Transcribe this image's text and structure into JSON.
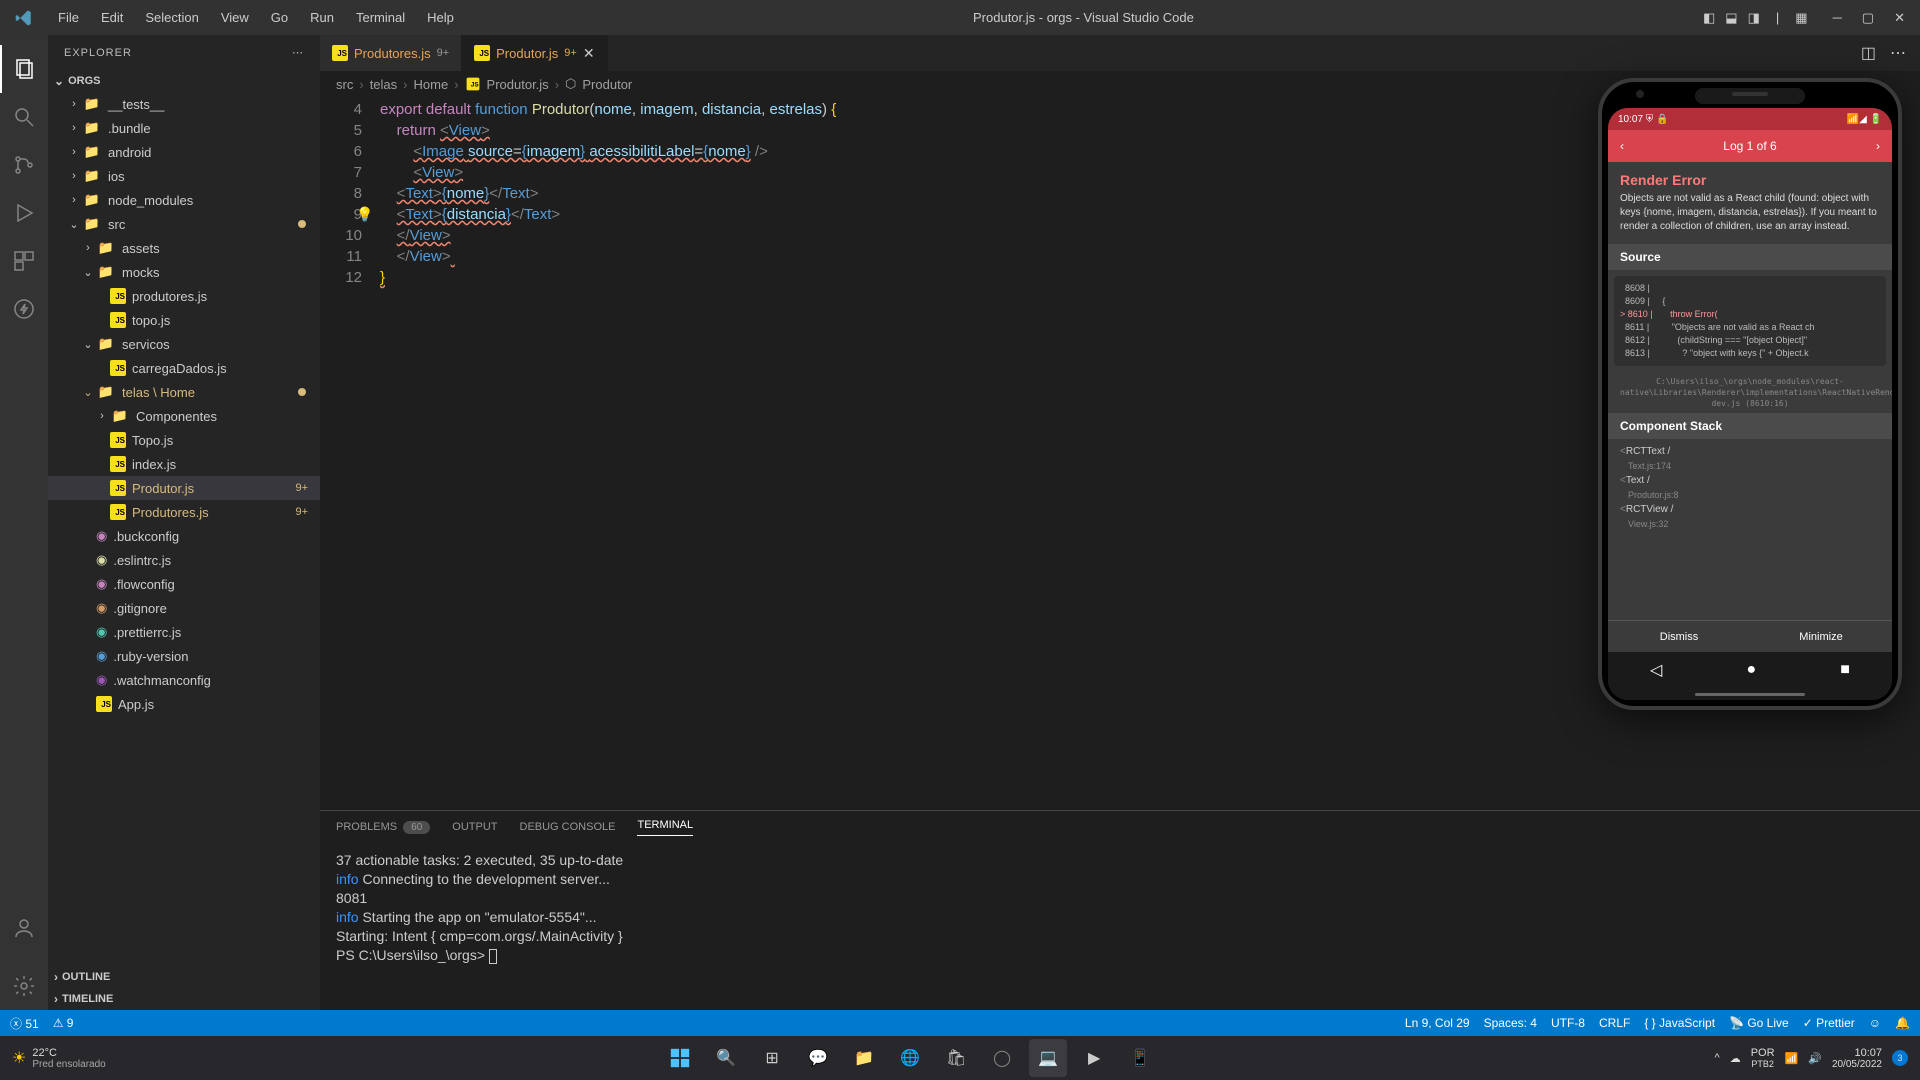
{
  "titlebar": {
    "menus": [
      "File",
      "Edit",
      "Selection",
      "View",
      "Go",
      "Run",
      "Terminal",
      "Help"
    ],
    "title": "Produtor.js - orgs - Visual Studio Code"
  },
  "sidebar": {
    "header": "EXPLORER",
    "project": "ORGS",
    "tree": [
      {
        "indent": 1,
        "chev": "›",
        "icon": "folder",
        "name": "__tests__"
      },
      {
        "indent": 1,
        "chev": "›",
        "icon": "folder",
        "name": ".bundle"
      },
      {
        "indent": 1,
        "chev": "›",
        "icon": "folder-g",
        "name": "android"
      },
      {
        "indent": 1,
        "chev": "›",
        "icon": "folder",
        "name": "ios"
      },
      {
        "indent": 1,
        "chev": "›",
        "icon": "folder-g",
        "name": "node_modules"
      },
      {
        "indent": 1,
        "chev": "⌄",
        "icon": "folder-g",
        "name": "src",
        "dot": true
      },
      {
        "indent": 2,
        "chev": "›",
        "icon": "folder",
        "name": "assets"
      },
      {
        "indent": 2,
        "chev": "⌄",
        "icon": "folder",
        "name": "mocks"
      },
      {
        "indent": 3,
        "icon": "js",
        "name": "produtores.js"
      },
      {
        "indent": 3,
        "icon": "js",
        "name": "topo.js"
      },
      {
        "indent": 2,
        "chev": "⌄",
        "icon": "folder",
        "name": "servicos"
      },
      {
        "indent": 3,
        "icon": "js",
        "name": "carregaDados.js"
      },
      {
        "indent": 2,
        "chev": "⌄",
        "icon": "folder-r",
        "name": "telas \\ Home",
        "dot": true,
        "mod": true
      },
      {
        "indent": 3,
        "chev": "›",
        "icon": "folder",
        "name": "Componentes"
      },
      {
        "indent": 3,
        "icon": "js",
        "name": "Topo.js"
      },
      {
        "indent": 3,
        "icon": "js",
        "name": "index.js"
      },
      {
        "indent": 3,
        "icon": "js",
        "name": "Produtor.js",
        "badge": "9+",
        "active": true,
        "mod": true
      },
      {
        "indent": 3,
        "icon": "js",
        "name": "Produtores.js",
        "badge": "9+",
        "mod": true
      },
      {
        "indent": 2,
        "icon": "dot-p",
        "name": ".buckconfig"
      },
      {
        "indent": 2,
        "icon": "dot-y",
        "name": ".eslintrc.js"
      },
      {
        "indent": 2,
        "icon": "dot-p",
        "name": ".flowconfig"
      },
      {
        "indent": 2,
        "icon": "dot-o",
        "name": ".gitignore"
      },
      {
        "indent": 2,
        "icon": "dot-t",
        "name": ".prettierrc.js"
      },
      {
        "indent": 2,
        "icon": "dot-b",
        "name": ".ruby-version"
      },
      {
        "indent": 2,
        "icon": "dot-pu",
        "name": ".watchmanconfig"
      },
      {
        "indent": 2,
        "icon": "js",
        "name": "App.js"
      }
    ],
    "outline": "OUTLINE",
    "timeline": "TIMELINE"
  },
  "tabs": [
    {
      "icon": "js",
      "name": "Produtores.js",
      "badge": "9+",
      "active": false
    },
    {
      "icon": "js",
      "name": "Produtor.js",
      "badge": "9+",
      "active": true,
      "close": true
    }
  ],
  "breadcrumb": [
    "src",
    "telas",
    "Home",
    "Produtor.js",
    "Produtor"
  ],
  "code": {
    "start": 4,
    "lines": [
      "export default function Produtor(nome, imagem, distancia, estrelas) {",
      "    return <View>",
      "        <Image source={imagem} acessibilitiLabel={nome} />",
      "        <View>",
      "    <Text>{nome}</Text>",
      "    <Text>{distancia}</Text>",
      "    </View>",
      "    </View>",
      "}"
    ]
  },
  "panel": {
    "tabs": {
      "problems": "PROBLEMS",
      "problems_count": "60",
      "output": "OUTPUT",
      "debug": "DEBUG CONSOLE",
      "terminal": "TERMINAL"
    },
    "terminal": [
      {
        "t": "37 actionable tasks: 2 executed, 35 up-to-date"
      },
      {
        "p": "info",
        "t": " Connecting to the development server..."
      },
      {
        "t": "8081"
      },
      {
        "p": "info",
        "t": " Starting the app on \"emulator-5554\"..."
      },
      {
        "t": "Starting: Intent { cmp=com.orgs/.MainActivity }"
      },
      {
        "t": "PS C:\\Users\\ilso_\\orgs> "
      }
    ]
  },
  "statusbar": {
    "errors": "51",
    "warnings": "9",
    "pos": "Ln 9, Col 29",
    "spaces": "Spaces: 4",
    "enc": "UTF-8",
    "eol": "CRLF",
    "lang_icon": "{ }",
    "lang": "JavaScript",
    "golive": "Go Live",
    "prettier": "Prettier"
  },
  "phone": {
    "time": "10:07",
    "nav": "Log 1 of 6",
    "err_title": "Render Error",
    "err_msg": "Objects are not valid as a React child (found: object with keys {nome, imagem, distancia, estrelas}). If you meant to render a collection of children, use an array instead.",
    "source": "Source",
    "src_lines": [
      {
        "n": "8608",
        "t": ""
      },
      {
        "n": "8609",
        "t": "    {"
      },
      {
        "n": "8610",
        "t": "      throw Error(",
        "err": true
      },
      {
        "n": "8611",
        "t": "        \"Objects are not valid as a React ch"
      },
      {
        "n": "8612",
        "t": "          (childString === \"[object Object]\""
      },
      {
        "n": "8613",
        "t": "            ? \"object with keys {\" + Object.k"
      }
    ],
    "src_path": "C:\\Users\\ilso_\\orgs\\node_modules\\react-native\\Libraries\\Renderer\\implementations\\ReactNativeRenderer-dev.js (8610:16)",
    "comp_stack": "Component Stack",
    "stack": [
      {
        "c": "<RCTText />",
        "f": "Text.js:174"
      },
      {
        "c": "<Text />",
        "f": "Produtor.js:8"
      },
      {
        "c": "<RCTView />",
        "f": "View.js:32"
      }
    ],
    "dismiss": "Dismiss",
    "minimize": "Minimize"
  },
  "taskbar": {
    "temp": "22°C",
    "weather": "Pred ensolarado",
    "lang": "POR",
    "lang2": "PTB2",
    "time": "10:07",
    "date": "20/05/2022"
  }
}
